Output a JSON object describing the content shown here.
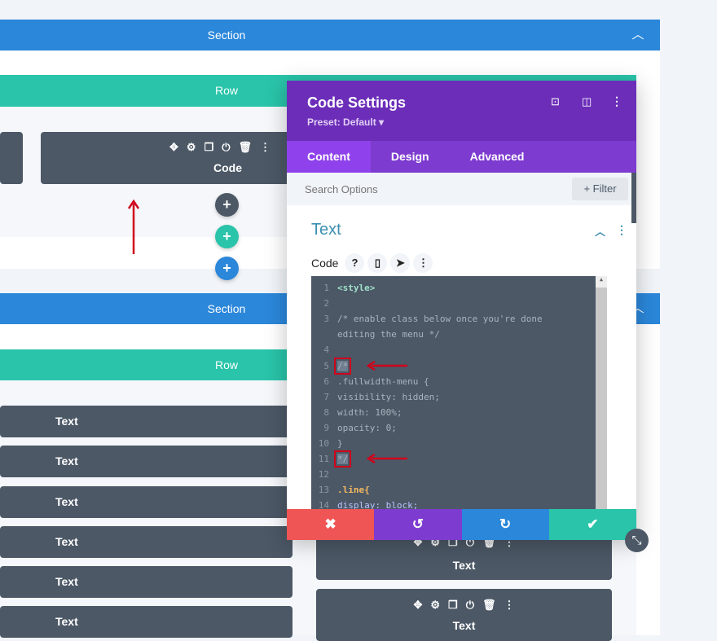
{
  "builder": {
    "section1": {
      "label": "Section",
      "row": "Row",
      "code_module": "Code"
    },
    "section2": {
      "label": "Section",
      "row": "Row",
      "left_modules": [
        "Text",
        "Text",
        "Text",
        "Text",
        "Text",
        "Text"
      ],
      "right_modules": [
        "Text",
        "Text"
      ]
    }
  },
  "modal": {
    "title": "Code Settings",
    "preset": "Preset: Default",
    "tabs": [
      "Content",
      "Design",
      "Advanced"
    ],
    "search_placeholder": "Search Options",
    "filter_label": "Filter",
    "group_title": "Text",
    "field_label": "Code",
    "code_lines": [
      {
        "n": "1",
        "t": "<style>"
      },
      {
        "n": "2",
        "t": ""
      },
      {
        "n": "3",
        "t": "/* enable class below once you're done"
      },
      {
        "n": "",
        "t": "editing the menu */"
      },
      {
        "n": "4",
        "t": ""
      },
      {
        "n": "5",
        "t": "/*"
      },
      {
        "n": "6",
        "t": ".fullwidth-menu {"
      },
      {
        "n": "7",
        "t": "visibility: hidden;"
      },
      {
        "n": "8",
        "t": "width: 100%;"
      },
      {
        "n": "9",
        "t": "opacity: 0;"
      },
      {
        "n": "10",
        "t": "}"
      },
      {
        "n": "11",
        "t": "*/"
      },
      {
        "n": "12",
        "t": ""
      },
      {
        "n": "13",
        "t": ".line{"
      },
      {
        "n": "14",
        "t": "display: block;"
      }
    ]
  },
  "colors": {
    "section": "#2b87da",
    "row": "#29c4a9",
    "module": "#4c5866",
    "modal_header": "#6c2eb9",
    "cancel": "#ef5555",
    "undo": "#7e3bd0",
    "redo": "#2b87da",
    "save": "#29c4a9",
    "annotation": "#d0021b"
  }
}
